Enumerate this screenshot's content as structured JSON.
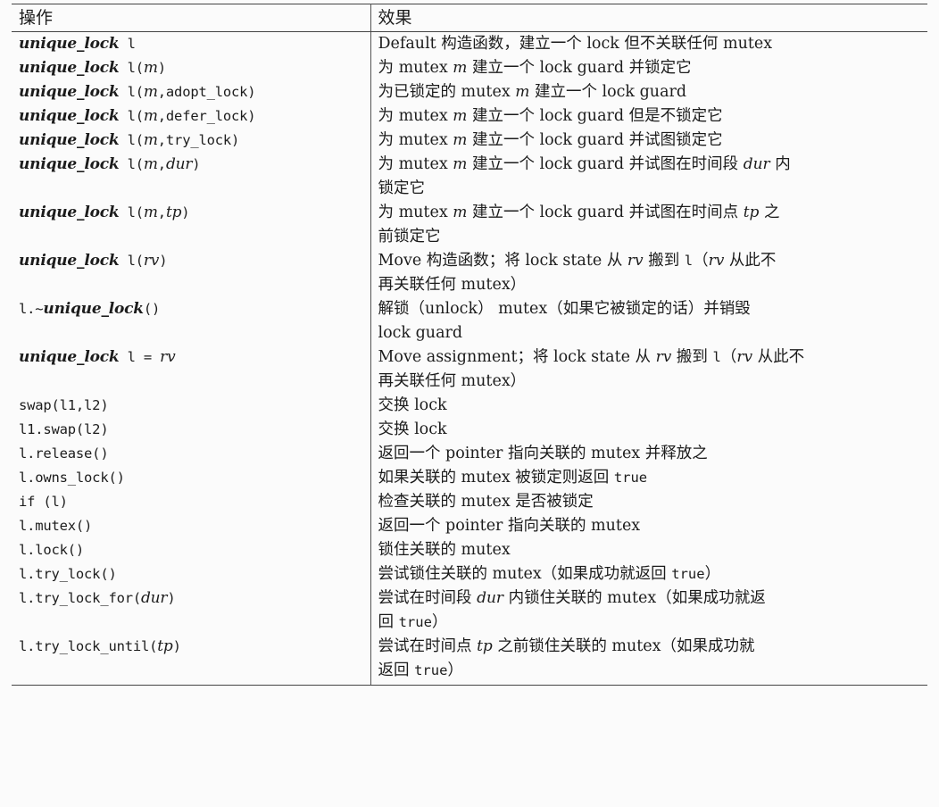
{
  "header": {
    "col_op": "操作",
    "col_effect": "效果"
  },
  "rows": [
    {
      "op": [
        {
          "k": "kw",
          "t": "unique_lock"
        },
        {
          "k": "m",
          "t": " "
        },
        {
          "k": "m",
          "t": "l"
        }
      ],
      "effect": [
        {
          "k": "t",
          "t": "Default 构造函数，建立一个 lock 但不关联任何 mutex"
        }
      ]
    },
    {
      "op": [
        {
          "k": "kw",
          "t": "unique_lock"
        },
        {
          "k": "m",
          "t": " "
        },
        {
          "k": "m",
          "t": "l("
        },
        {
          "k": "v",
          "t": "m"
        },
        {
          "k": "m",
          "t": ")"
        }
      ],
      "effect": [
        {
          "k": "t",
          "t": "为 mutex "
        },
        {
          "k": "v",
          "t": "m"
        },
        {
          "k": "t",
          "t": " 建立一个 lock guard 并锁定它"
        }
      ]
    },
    {
      "op": [
        {
          "k": "kw",
          "t": "unique_lock"
        },
        {
          "k": "m",
          "t": " "
        },
        {
          "k": "m",
          "t": "l("
        },
        {
          "k": "v",
          "t": "m"
        },
        {
          "k": "m",
          "t": ",adopt_lock)"
        }
      ],
      "effect": [
        {
          "k": "t",
          "t": "为已锁定的 mutex "
        },
        {
          "k": "v",
          "t": "m"
        },
        {
          "k": "t",
          "t": " 建立一个 lock guard"
        }
      ]
    },
    {
      "op": [
        {
          "k": "kw",
          "t": "unique_lock"
        },
        {
          "k": "m",
          "t": " "
        },
        {
          "k": "m",
          "t": "l("
        },
        {
          "k": "v",
          "t": "m"
        },
        {
          "k": "m",
          "t": ",defer_lock)"
        }
      ],
      "effect": [
        {
          "k": "t",
          "t": "为 mutex "
        },
        {
          "k": "v",
          "t": "m"
        },
        {
          "k": "t",
          "t": " 建立一个 lock guard 但是不锁定它"
        }
      ]
    },
    {
      "op": [
        {
          "k": "kw",
          "t": "unique_lock"
        },
        {
          "k": "m",
          "t": " "
        },
        {
          "k": "m",
          "t": "l("
        },
        {
          "k": "v",
          "t": "m"
        },
        {
          "k": "m",
          "t": ",try_lock)"
        }
      ],
      "effect": [
        {
          "k": "t",
          "t": "为 mutex "
        },
        {
          "k": "v",
          "t": "m"
        },
        {
          "k": "t",
          "t": " 建立一个 lock guard 并试图锁定它"
        }
      ]
    },
    {
      "op": [
        {
          "k": "kw",
          "t": "unique_lock"
        },
        {
          "k": "m",
          "t": " "
        },
        {
          "k": "m",
          "t": "l("
        },
        {
          "k": "v",
          "t": "m"
        },
        {
          "k": "m",
          "t": ","
        },
        {
          "k": "v",
          "t": "dur"
        },
        {
          "k": "m",
          "t": ")"
        }
      ],
      "effect": [
        {
          "k": "t",
          "t": "为 mutex "
        },
        {
          "k": "v",
          "t": "m"
        },
        {
          "k": "t",
          "t": " 建立一个 lock guard 并试图在时间段 "
        },
        {
          "k": "v",
          "t": "dur"
        },
        {
          "k": "t",
          "t": " 内"
        },
        {
          "k": "br"
        },
        {
          "k": "t",
          "t": "锁定它"
        }
      ]
    },
    {
      "op": [
        {
          "k": "kw",
          "t": "unique_lock"
        },
        {
          "k": "m",
          "t": " "
        },
        {
          "k": "m",
          "t": "l("
        },
        {
          "k": "v",
          "t": "m"
        },
        {
          "k": "m",
          "t": ","
        },
        {
          "k": "v",
          "t": "tp"
        },
        {
          "k": "m",
          "t": ")"
        }
      ],
      "effect": [
        {
          "k": "t",
          "t": "为 mutex "
        },
        {
          "k": "v",
          "t": "m"
        },
        {
          "k": "t",
          "t": " 建立一个 lock guard 并试图在时间点 "
        },
        {
          "k": "v",
          "t": "tp"
        },
        {
          "k": "t",
          "t": " 之"
        },
        {
          "k": "br"
        },
        {
          "k": "t",
          "t": "前锁定它"
        }
      ]
    },
    {
      "op": [
        {
          "k": "kw",
          "t": "unique_lock"
        },
        {
          "k": "m",
          "t": " "
        },
        {
          "k": "m",
          "t": "l("
        },
        {
          "k": "v",
          "t": "rv"
        },
        {
          "k": "m",
          "t": ")"
        }
      ],
      "effect": [
        {
          "k": "t",
          "t": "Move 构造函数；将 lock state 从 "
        },
        {
          "k": "v",
          "t": "rv"
        },
        {
          "k": "t",
          "t": " 搬到 "
        },
        {
          "k": "m",
          "t": "l"
        },
        {
          "k": "t",
          "t": "（"
        },
        {
          "k": "v",
          "t": "rv"
        },
        {
          "k": "t",
          "t": " 从此不"
        },
        {
          "k": "br"
        },
        {
          "k": "t",
          "t": "再关联任何 mutex）"
        }
      ]
    },
    {
      "op": [
        {
          "k": "m",
          "t": "l.~"
        },
        {
          "k": "kw",
          "t": "unique_lock"
        },
        {
          "k": "m",
          "t": "()"
        }
      ],
      "effect": [
        {
          "k": "t",
          "t": "解锁（unlock） mutex（如果它被锁定的话）并销毁"
        },
        {
          "k": "br"
        },
        {
          "k": "t",
          "t": "lock guard"
        }
      ]
    },
    {
      "op": [
        {
          "k": "kw",
          "t": "unique_lock"
        },
        {
          "k": "m",
          "t": " "
        },
        {
          "k": "m",
          "t": "l = "
        },
        {
          "k": "v",
          "t": "rv"
        }
      ],
      "effect": [
        {
          "k": "t",
          "t": "Move assignment；将 lock state 从 "
        },
        {
          "k": "v",
          "t": "rv"
        },
        {
          "k": "t",
          "t": " 搬到 "
        },
        {
          "k": "m",
          "t": "l"
        },
        {
          "k": "t",
          "t": "（"
        },
        {
          "k": "v",
          "t": "rv"
        },
        {
          "k": "t",
          "t": " 从此不"
        },
        {
          "k": "br"
        },
        {
          "k": "t",
          "t": "再关联任何 mutex）"
        }
      ]
    },
    {
      "op": [
        {
          "k": "m",
          "t": "swap(l1,l2)"
        }
      ],
      "effect": [
        {
          "k": "t",
          "t": "交换 lock"
        }
      ]
    },
    {
      "op": [
        {
          "k": "m",
          "t": "l1.swap(l2)"
        }
      ],
      "effect": [
        {
          "k": "t",
          "t": "交换 lock"
        }
      ]
    },
    {
      "op": [
        {
          "k": "m",
          "t": "l.release()"
        }
      ],
      "effect": [
        {
          "k": "t",
          "t": "返回一个 pointer 指向关联的 mutex 并释放之"
        }
      ]
    },
    {
      "op": [
        {
          "k": "m",
          "t": "l.owns_lock()"
        }
      ],
      "effect": [
        {
          "k": "t",
          "t": "如果关联的 mutex 被锁定则返回 "
        },
        {
          "k": "m",
          "t": "true"
        }
      ]
    },
    {
      "op": [
        {
          "k": "m",
          "t": "if (l)"
        }
      ],
      "effect": [
        {
          "k": "t",
          "t": "检查关联的 mutex 是否被锁定"
        }
      ]
    },
    {
      "op": [
        {
          "k": "m",
          "t": "l.mutex()"
        }
      ],
      "effect": [
        {
          "k": "t",
          "t": "返回一个 pointer 指向关联的 mutex"
        }
      ]
    },
    {
      "op": [
        {
          "k": "m",
          "t": "l.lock()"
        }
      ],
      "effect": [
        {
          "k": "t",
          "t": "锁住关联的 mutex"
        }
      ]
    },
    {
      "op": [
        {
          "k": "m",
          "t": "l.try_lock()"
        }
      ],
      "effect": [
        {
          "k": "t",
          "t": "尝试锁住关联的 mutex（如果成功就返回 "
        },
        {
          "k": "m",
          "t": "true"
        },
        {
          "k": "t",
          "t": "）"
        }
      ]
    },
    {
      "op": [
        {
          "k": "m",
          "t": "l.try_lock_for("
        },
        {
          "k": "v",
          "t": "dur"
        },
        {
          "k": "m",
          "t": ")"
        }
      ],
      "effect": [
        {
          "k": "t",
          "t": "尝试在时间段 "
        },
        {
          "k": "v",
          "t": "dur"
        },
        {
          "k": "t",
          "t": " 内锁住关联的 mutex（如果成功就返"
        },
        {
          "k": "br"
        },
        {
          "k": "t",
          "t": "回 "
        },
        {
          "k": "m",
          "t": "true"
        },
        {
          "k": "t",
          "t": "）"
        }
      ]
    },
    {
      "op": [
        {
          "k": "m",
          "t": "l.try_lock_until("
        },
        {
          "k": "v",
          "t": "tp"
        },
        {
          "k": "m",
          "t": ")"
        }
      ],
      "effect": [
        {
          "k": "t",
          "t": "尝试在时间点 "
        },
        {
          "k": "v",
          "t": "tp"
        },
        {
          "k": "t",
          "t": " 之前锁住关联的 mutex（如果成功就"
        },
        {
          "k": "br"
        },
        {
          "k": "t",
          "t": "返回 "
        },
        {
          "k": "m",
          "t": "true"
        },
        {
          "k": "t",
          "t": "）"
        }
      ]
    }
  ]
}
